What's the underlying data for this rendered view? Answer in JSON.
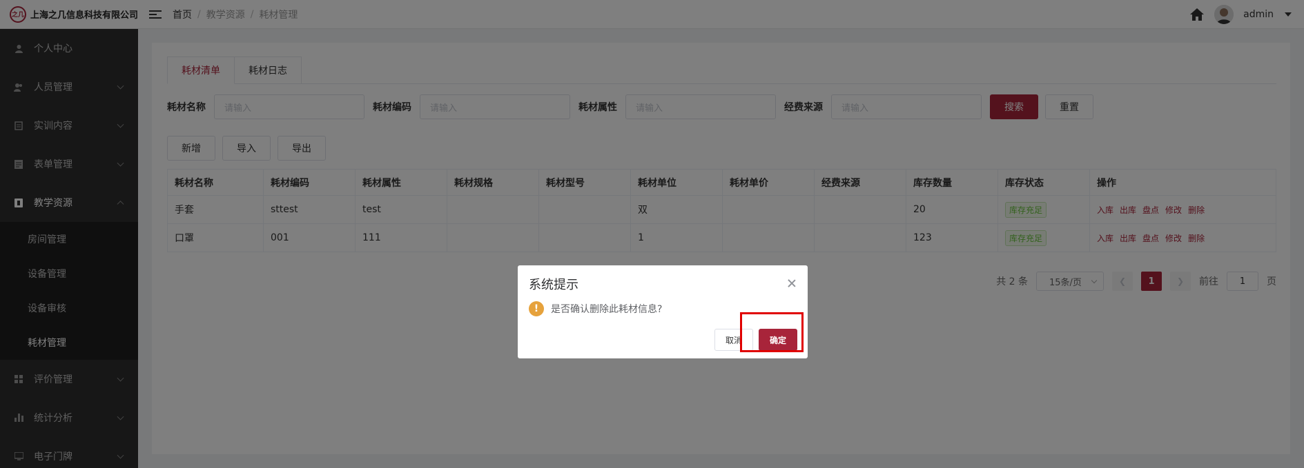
{
  "header": {
    "logo_text": "之几",
    "company": "上海之几信息科技有限公司",
    "breadcrumb": [
      "首页",
      "教学资源",
      "耗材管理"
    ],
    "breadcrumb_sep": "/",
    "user": "admin"
  },
  "sidebar": {
    "items": [
      {
        "label": "个人中心",
        "icon": "user-icon"
      },
      {
        "label": "人员管理",
        "icon": "users-icon"
      },
      {
        "label": "实训内容",
        "icon": "training-icon"
      },
      {
        "label": "表单管理",
        "icon": "form-icon"
      },
      {
        "label": "教学资源",
        "icon": "resource-icon"
      },
      {
        "label": "评价管理",
        "icon": "evaluate-icon"
      },
      {
        "label": "统计分析",
        "icon": "chart-icon"
      },
      {
        "label": "电子门牌",
        "icon": "doorplate-icon"
      }
    ],
    "sub_items": [
      "房间管理",
      "设备管理",
      "设备审核",
      "耗材管理"
    ]
  },
  "tabs": [
    "耗材清单",
    "耗材日志"
  ],
  "filters": {
    "labels": [
      "耗材名称",
      "耗材编码",
      "耗材属性",
      "经费来源"
    ],
    "placeholder": "请输入",
    "search": "搜索",
    "reset": "重置"
  },
  "actions": [
    "新增",
    "导入",
    "导出"
  ],
  "table": {
    "headers": [
      "耗材名称",
      "耗材编码",
      "耗材属性",
      "耗材规格",
      "耗材型号",
      "耗材单位",
      "耗材单价",
      "经费来源",
      "库存数量",
      "库存状态",
      "操作"
    ],
    "rows": [
      {
        "name": "手套",
        "code": "sttest",
        "attr": "test",
        "spec": "",
        "model": "",
        "unit": "双",
        "price": "",
        "fund": "",
        "qty": "20",
        "status": "库存充足"
      },
      {
        "name": "口罩",
        "code": "001",
        "attr": "111",
        "spec": "",
        "model": "",
        "unit": "1",
        "price": "",
        "fund": "",
        "qty": "123",
        "status": "库存充足"
      }
    ],
    "ops": [
      "入库",
      "出库",
      "盘点",
      "修改",
      "删除"
    ]
  },
  "pager": {
    "total": "共 2 条",
    "size": "15条/页",
    "current": "1",
    "goto": "前往",
    "goto_value": "1",
    "page_unit": "页"
  },
  "dialog": {
    "title": "系统提示",
    "message": "是否确认删除此耗材信息?",
    "cancel": "取消",
    "confirm": "确定"
  },
  "colors": {
    "accent": "#a8243a",
    "sidebar": "#2f2f2f",
    "warning": "#e6a23c",
    "highlight": "#e00000"
  }
}
